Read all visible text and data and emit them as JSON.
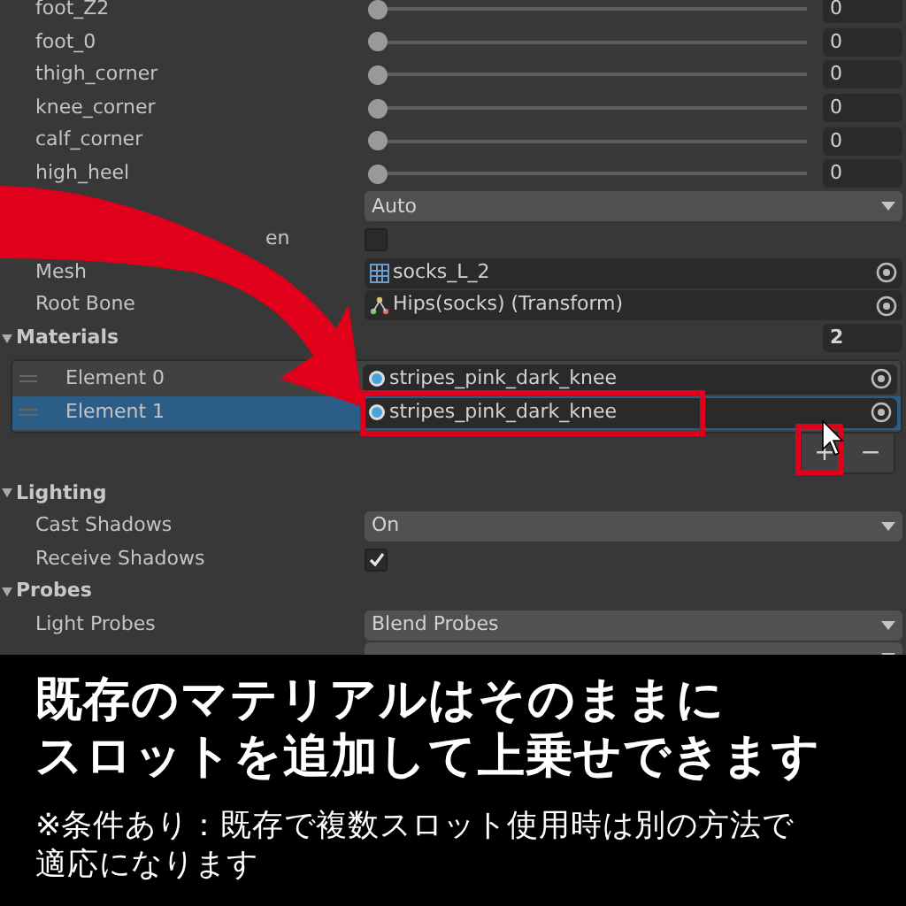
{
  "rows": [
    {
      "kind": "slider",
      "label": "foot_Z2",
      "level": 0,
      "value": "0"
    },
    {
      "kind": "slider",
      "label": "foot_0",
      "level": 0,
      "value": "0"
    },
    {
      "kind": "slider",
      "label": "thigh_corner",
      "level": 0,
      "value": "0"
    },
    {
      "kind": "slider",
      "label": "knee_corner",
      "level": 0,
      "value": "0"
    },
    {
      "kind": "slider",
      "label": "calf_corner",
      "level": 0,
      "value": "0"
    },
    {
      "kind": "slider",
      "label": "high_heel",
      "level": 0,
      "value": "0"
    },
    {
      "kind": "dropdown",
      "value": "Auto"
    },
    {
      "kind": "checkbox",
      "label": "en",
      "checked": false
    },
    {
      "kind": "object",
      "label": "Mesh",
      "value": "socks_L_2"
    },
    {
      "kind": "object",
      "label": "Root Bone",
      "value": "Hips(socks) (Transform)"
    },
    {
      "kind": "section",
      "label": "Materials",
      "expanded": true,
      "count": "2"
    },
    {
      "kind": "list",
      "elements": [
        {
          "label": "Element 0",
          "value": "stripes_pink_dark_knee",
          "selected": false
        },
        {
          "label": "Element 1",
          "value": "stripes_pink_dark_knee",
          "selected": true
        }
      ],
      "add": "+",
      "remove": "−"
    },
    {
      "kind": "section",
      "label": "Lighting",
      "expanded": true
    },
    {
      "kind": "dropdown",
      "label": "Cast Shadows",
      "value": "On"
    },
    {
      "kind": "checkbox",
      "label": "Receive Shadows",
      "checked": true
    },
    {
      "kind": "section",
      "label": "Probes",
      "expanded": true
    },
    {
      "kind": "dropdown",
      "label": "Light Probes",
      "value": "Blend Probes"
    },
    {
      "kind": "dropdown"
    }
  ],
  "caption": {
    "headline": [
      "既存のマテリアルはそのままに",
      "スロットを追加して上乗せできます"
    ],
    "note": [
      "※条件あり：既存で複数スロット使用時は別の方法で",
      "適応になります"
    ]
  }
}
